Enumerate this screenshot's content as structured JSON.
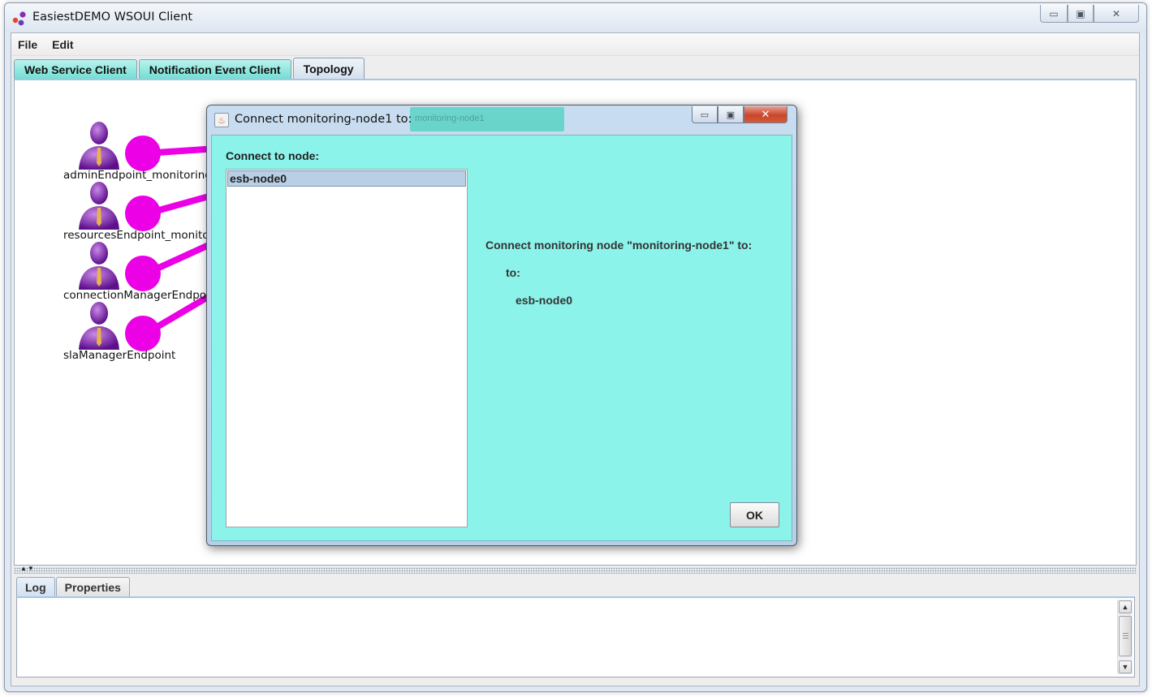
{
  "window": {
    "title": "EasiestDEMO WSOUI Client",
    "controls": {
      "minimize": "▭",
      "maximize": "▣",
      "close": "✕"
    }
  },
  "menu": {
    "items": [
      "File",
      "Edit"
    ]
  },
  "tabs": [
    {
      "label": "Web Service Client",
      "active": false
    },
    {
      "label": "Notification Event Client",
      "active": false
    },
    {
      "label": "Topology",
      "active": true
    }
  ],
  "topology": {
    "nodes": [
      {
        "label": "adminEndpoint_monitoring"
      },
      {
        "label": "resourcesEndpoint_monitoring"
      },
      {
        "label": "connectionManagerEndpoint"
      },
      {
        "label": "slaManagerEndpoint"
      }
    ],
    "colors": {
      "node_person": "#7a1ca6",
      "edge": "#ec00e6",
      "accent_tab": "#73ded3",
      "dialog_bg": "#8cf3ea"
    }
  },
  "bottom_tabs": [
    {
      "label": "Log",
      "active": true
    },
    {
      "label": "Properties",
      "active": false
    }
  ],
  "dialog": {
    "title": "Connect monitoring-node1 to:",
    "ghost_label": "monitoring-node1",
    "connect_label": "Connect to node:",
    "list_items": [
      "esb-node0"
    ],
    "info_line1": "Connect monitoring node  \"monitoring-node1\" to:",
    "info_line2": "to:",
    "info_line3": "esb-node0",
    "ok_label": "OK",
    "controls": {
      "minimize": "▭",
      "maximize": "▣",
      "close": "✕"
    }
  }
}
